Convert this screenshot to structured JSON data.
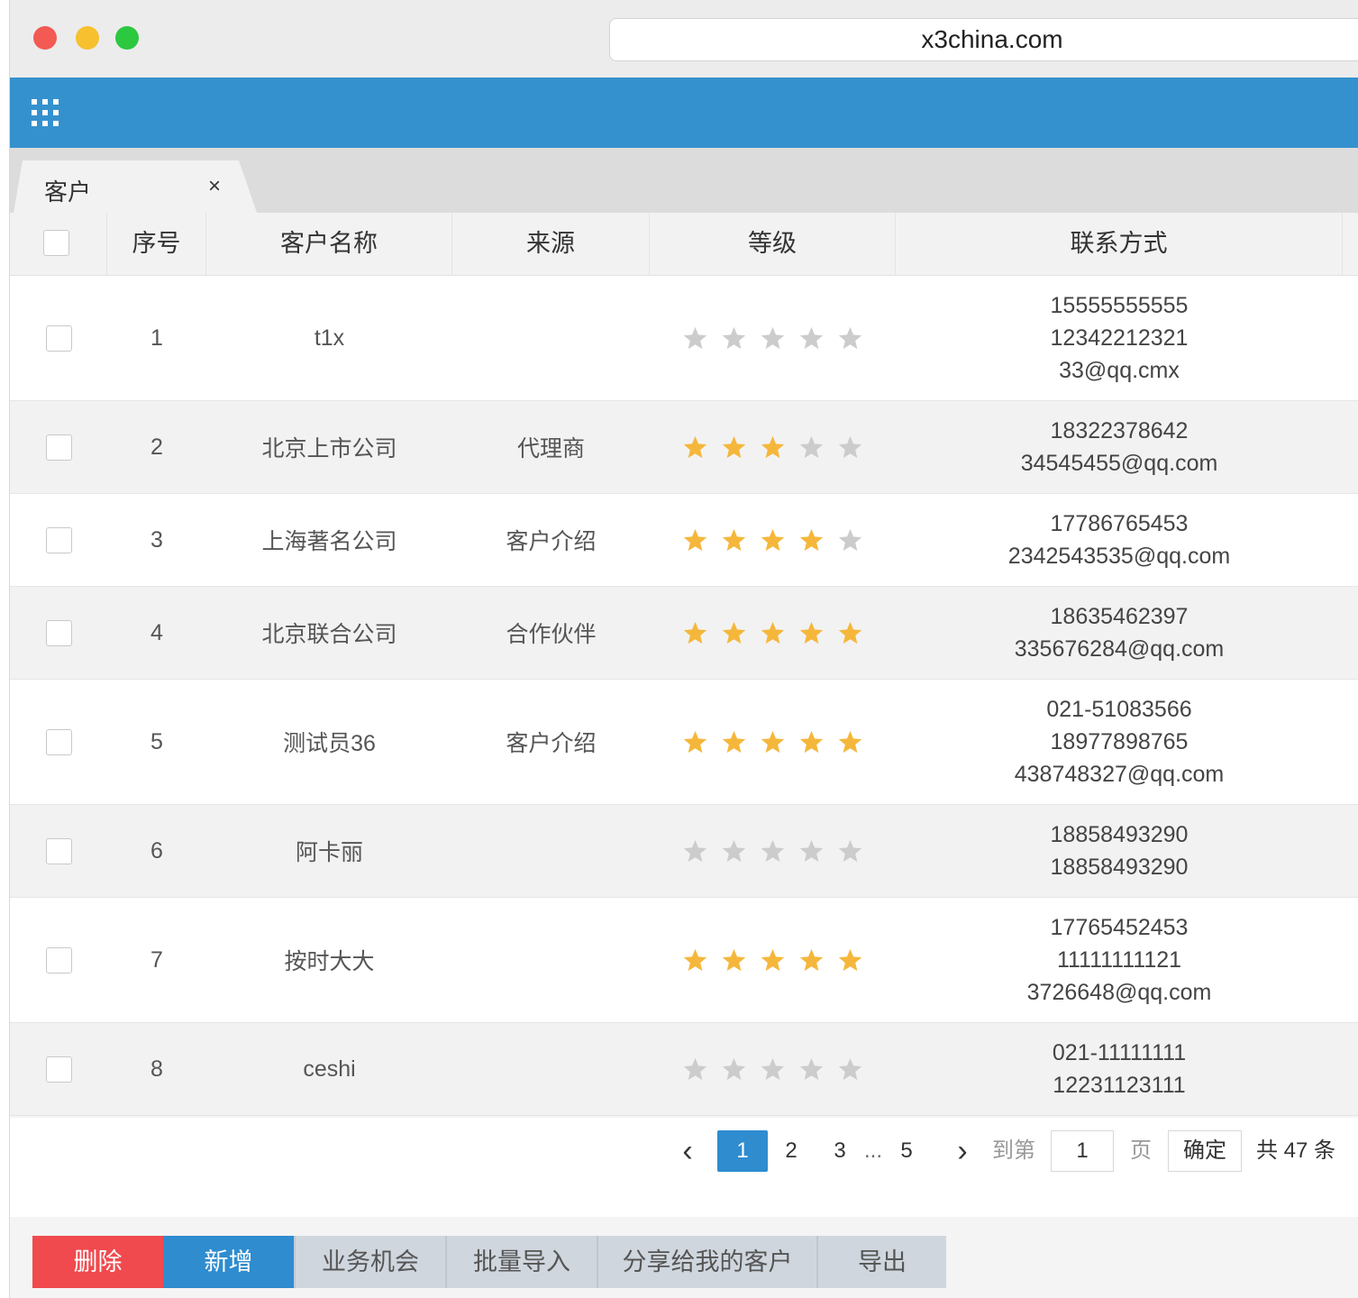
{
  "browser": {
    "url": "x3china.com"
  },
  "appbar": {
    "menu_icon": "grid-menu-icon"
  },
  "tabs": [
    {
      "label": "客户",
      "close": "×"
    }
  ],
  "table": {
    "columns": [
      "序号",
      "客户名称",
      "来源",
      "等级",
      "联系方式"
    ],
    "rows": [
      {
        "index": "1",
        "name": "t1x",
        "source": "",
        "level": 0,
        "contact": [
          "15555555555",
          "12342212321",
          "33@qq.cmx"
        ]
      },
      {
        "index": "2",
        "name": "北京上市公司",
        "source": "代理商",
        "level": 3,
        "contact": [
          "18322378642",
          "34545455@qq.com"
        ]
      },
      {
        "index": "3",
        "name": "上海著名公司",
        "source": "客户介绍",
        "level": 4,
        "contact": [
          "17786765453",
          "2342543535@qq.com"
        ]
      },
      {
        "index": "4",
        "name": "北京联合公司",
        "source": "合作伙伴",
        "level": 5,
        "contact": [
          "18635462397",
          "335676284@qq.com"
        ]
      },
      {
        "index": "5",
        "name": "测试员36",
        "source": "客户介绍",
        "level": 5,
        "contact": [
          "021-51083566",
          "18977898765",
          "438748327@qq.com"
        ]
      },
      {
        "index": "6",
        "name": "阿卡丽",
        "source": "",
        "level": 0,
        "contact": [
          "18858493290",
          "18858493290"
        ]
      },
      {
        "index": "7",
        "name": "按时大大",
        "source": "",
        "level": 5,
        "contact": [
          "17765452453",
          "11111111121",
          "3726648@qq.com"
        ]
      },
      {
        "index": "8",
        "name": "ceshi",
        "source": "",
        "level": 0,
        "contact": [
          "021-11111111",
          "12231123111"
        ]
      }
    ],
    "star_colors": {
      "on": "#f5b73b",
      "off": "#cccccc"
    },
    "max_stars": 5
  },
  "pagination": {
    "prev": "‹",
    "pages": [
      "1",
      "2",
      "3"
    ],
    "ellipsis": "...",
    "last_page": "5",
    "next": "›",
    "goto_label": "到第",
    "goto_value": "1",
    "page_unit": "页",
    "confirm": "确定",
    "total": "共 47 条",
    "active_page": "1"
  },
  "toolbar": {
    "delete": "删除",
    "add": "新增",
    "opportunity": "业务机会",
    "batch_import": "批量导入",
    "shared": "分享给我的客户",
    "export": "导出"
  },
  "colors": {
    "accent": "#3591cd",
    "danger": "#f04a4e"
  }
}
